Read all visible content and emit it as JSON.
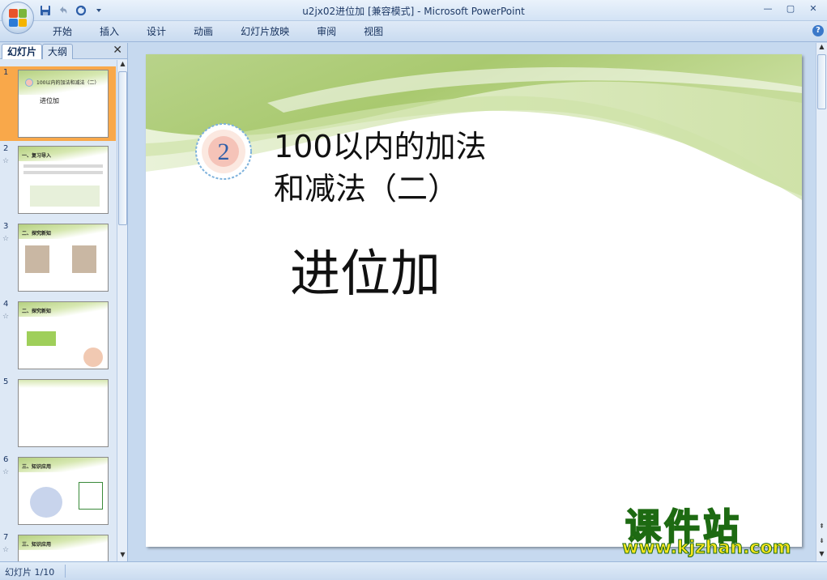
{
  "window": {
    "title": "u2jx02进位加 [兼容模式] - Microsoft PowerPoint",
    "controls": [
      "—",
      "▢",
      "✕"
    ]
  },
  "quick_access": {
    "icons": [
      "save-icon",
      "undo-icon",
      "redo-icon",
      "customize-icon"
    ]
  },
  "ribbon": {
    "tabs": [
      "开始",
      "插入",
      "设计",
      "动画",
      "幻灯片放映",
      "审阅",
      "视图"
    ],
    "help": "?"
  },
  "panel": {
    "tab_slides": "幻灯片",
    "tab_outline": "大纲",
    "close": "✕",
    "thumbnails": [
      {
        "num": "1",
        "star": "",
        "title": "100以内的加法和减法（二）",
        "sub": "进位加",
        "selected": true
      },
      {
        "num": "2",
        "star": "☆",
        "title": "一、复习导入",
        "sub": "",
        "selected": false
      },
      {
        "num": "3",
        "star": "☆",
        "title": "二、探究新知",
        "sub": "",
        "selected": false
      },
      {
        "num": "4",
        "star": "☆",
        "title": "二、探究新知",
        "sub": "",
        "selected": false
      },
      {
        "num": "5",
        "star": "",
        "title": "",
        "sub": "",
        "selected": false
      },
      {
        "num": "6",
        "star": "☆",
        "title": "三、知识应用",
        "sub": "",
        "selected": false
      },
      {
        "num": "7",
        "star": "☆",
        "title": "三、知识应用",
        "sub": "",
        "selected": false
      }
    ]
  },
  "slide": {
    "badge_number": "2",
    "title_line1": "100以内的加法",
    "title_line2": "和减法（二）",
    "subtitle": "进位加",
    "colors": {
      "wave_dark": "#9fc265",
      "wave_light": "#dcebc1",
      "badge_ring": "#7eb2dc",
      "badge_fill": "#f5c3b8",
      "badge_num": "#2f5fa8"
    }
  },
  "watermark": {
    "text_cn": "课件站",
    "url": "www.kjzhan.com"
  },
  "status": {
    "slide_counter": "幻灯片 1/10"
  }
}
